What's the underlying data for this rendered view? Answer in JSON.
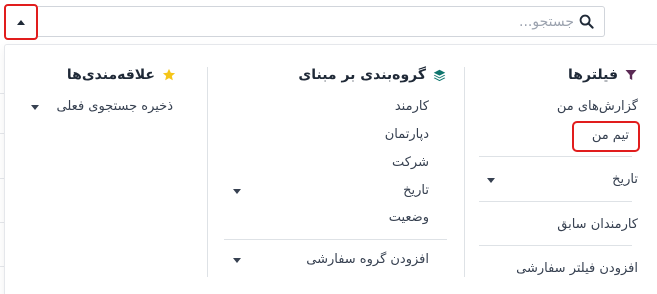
{
  "search": {
    "placeholder": "جستجو..."
  },
  "filters": {
    "title": "فیلترها",
    "items": [
      {
        "label": "گزارش‌های من"
      },
      {
        "label": "تیم من"
      }
    ],
    "date_label": "تاریخ",
    "former_employees_label": "کارمندان سابق",
    "add_custom_filter_label": "افزودن فیلتر سفارشی"
  },
  "group_by": {
    "title": "گروه‌بندی بر مبنای",
    "items": [
      {
        "label": "کارمند"
      },
      {
        "label": "دپارتمان"
      },
      {
        "label": "شرکت"
      },
      {
        "label": "تاریخ"
      },
      {
        "label": "وضعیت"
      }
    ],
    "add_custom_group_label": "افزودن گروه سفارشی"
  },
  "favorites": {
    "title": "علاقه‌مندی‌ها",
    "save_search_label": "ذخیره جستجوی فعلی"
  },
  "colors": {
    "highlight": "#e11d1d",
    "filter_icon": "#5b2a55",
    "group_icon": "#0f766e",
    "star_icon": "#f5c518"
  }
}
